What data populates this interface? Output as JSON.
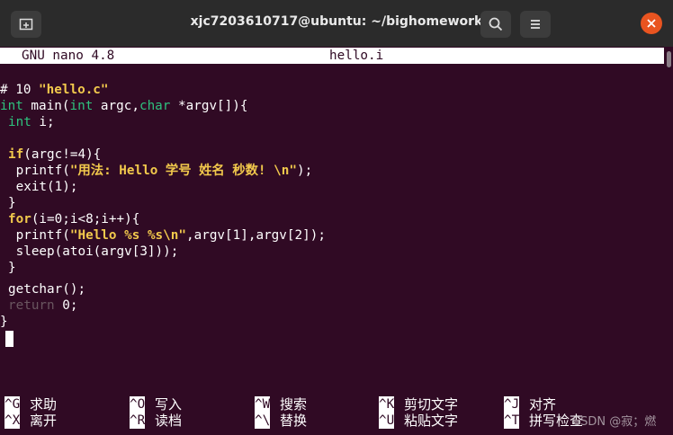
{
  "window": {
    "title": "xjc7203610717@ubuntu: ~/bighomework"
  },
  "icons": {
    "new_tab": "new-tab-icon",
    "search": "search-icon",
    "menu": "hamburger-menu-icon",
    "close": "close-icon"
  },
  "colors": {
    "terminal_bg": "#300a24",
    "titlebar_bg": "#2b2b2b",
    "keyword_green": "#2ec27e",
    "string_yellow": "#f2c94c",
    "close_button": "#e95420"
  },
  "nano": {
    "version": "GNU nano 4.8",
    "filename": "hello.i"
  },
  "code": {
    "line1_hash": "# 10 ",
    "line1_file": "\"hello.c\"",
    "line2_int": "int",
    "line2_a": " main(",
    "line2_int2": "int",
    "line2_b": " argc,",
    "line2_char": "char",
    "line2_c": " *argv[]){",
    "line3_int": "int",
    "line3_rest": " i;",
    "line5_if": "if",
    "line5_rest": "(argc!=4){",
    "line6_a": " printf(",
    "line6_str": "\"用法: Hello 学号 姓名 秒数! \\n\"",
    "line6_b": ");",
    "line7": " exit(1);",
    "line8": "}",
    "line9_for": "for",
    "line9_rest": "(i=0;i<8;i++){",
    "line10_a": " printf(",
    "line10_str": "\"Hello %s %s\\n\"",
    "line10_b": ",argv[1],argv[2]);",
    "line11": " sleep(atoi(argv[3]));",
    "line12": "}",
    "line13": "getchar();",
    "line14_return": "return",
    "line14_rest": " 0;",
    "line15": "}"
  },
  "shortcuts": [
    {
      "key": "^G",
      "label": "求助"
    },
    {
      "key": "^O",
      "label": "写入"
    },
    {
      "key": "^W",
      "label": "搜索"
    },
    {
      "key": "^K",
      "label": "剪切文字"
    },
    {
      "key": "^J",
      "label": "对齐"
    },
    {
      "key": "^X",
      "label": "离开"
    },
    {
      "key": "^R",
      "label": "读档"
    },
    {
      "key": "^\\",
      "label": "替换"
    },
    {
      "key": "^U",
      "label": "粘贴文字"
    },
    {
      "key": "^T",
      "label": "拼写检查"
    }
  ],
  "watermark": "CSDN @寂；燃"
}
